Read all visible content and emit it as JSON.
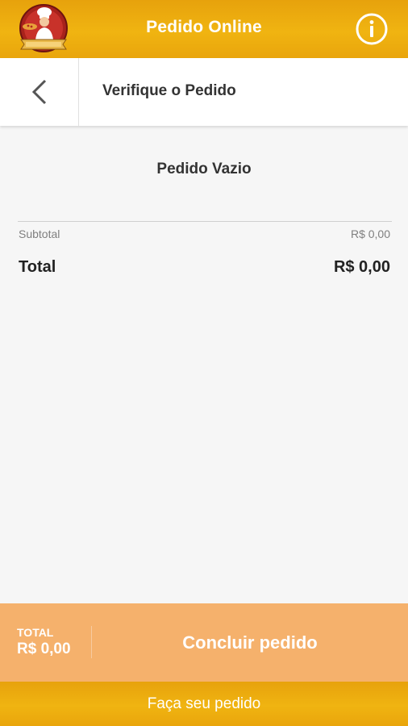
{
  "header": {
    "title": "Pedido Online",
    "logo_icon": "chef-logo-icon",
    "info_icon": "info-icon",
    "brand_color": "#f0b411"
  },
  "subheader": {
    "back_icon": "chevron-left-icon",
    "title": "Verifique o Pedido"
  },
  "cart": {
    "empty_message": "Pedido Vazio",
    "subtotal_label": "Subtotal",
    "subtotal_value": "R$ 0,00",
    "total_label": "Total",
    "total_value": "R$ 0,00"
  },
  "checkout": {
    "total_label": "TOTAL",
    "total_value": "R$ 0,00",
    "button_label": "Concluir pedido",
    "bar_color": "#f5b16c"
  },
  "footer": {
    "label": "Faça seu pedido"
  }
}
